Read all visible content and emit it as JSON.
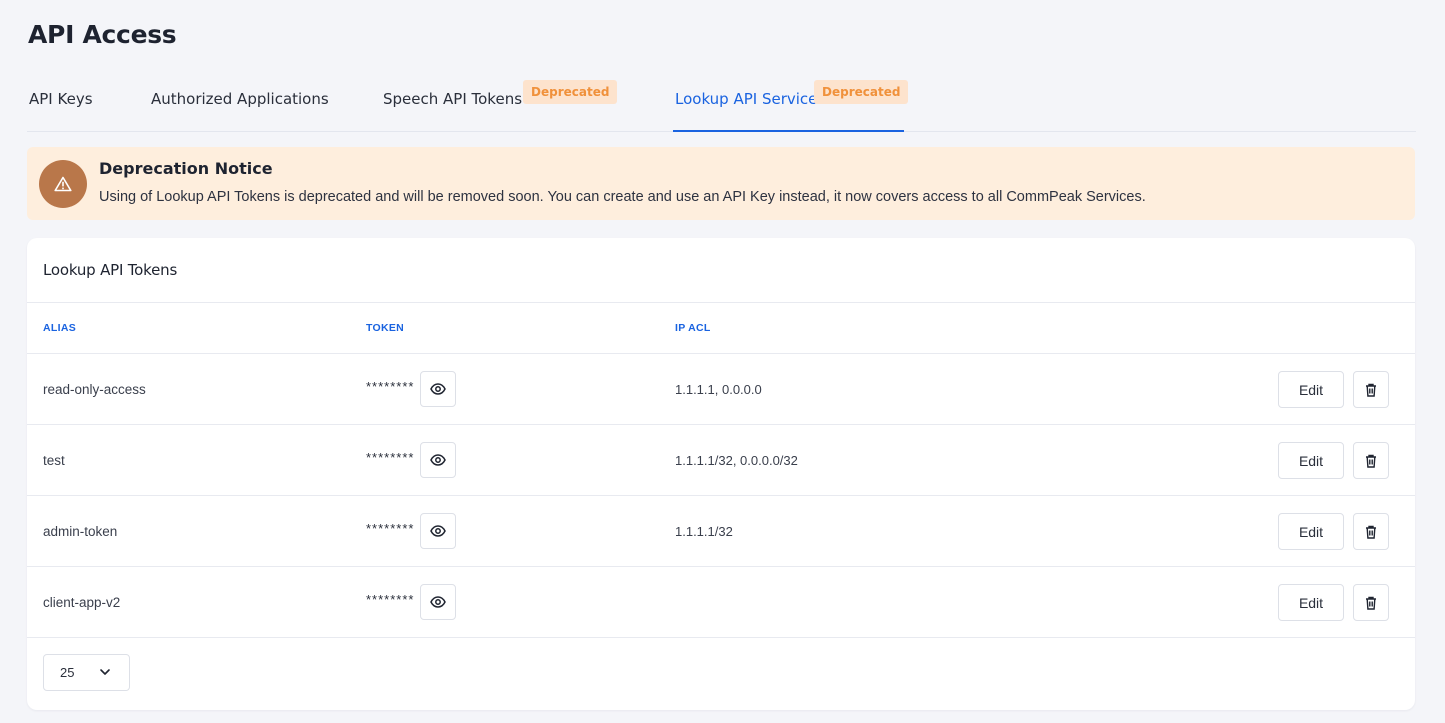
{
  "page_title": "API Access",
  "tabs": [
    {
      "label": "API Keys"
    },
    {
      "label": "Authorized Applications"
    },
    {
      "label": "Speech API Tokens",
      "badge": "Deprecated"
    },
    {
      "label": "Lookup API Service",
      "badge": "Deprecated",
      "active": true
    }
  ],
  "notice": {
    "title": "Deprecation Notice",
    "text": "Using of Lookup API Tokens is deprecated and will be removed soon. You can create and use an API Key instead, it now covers access to all CommPeak Services.",
    "icon": "warning-icon"
  },
  "card": {
    "title": "Lookup API Tokens",
    "columns": [
      "ALIAS",
      "TOKEN",
      "IP ACL"
    ],
    "rows": [
      {
        "alias": "read-only-access",
        "token": "********",
        "ip_acl": "1.1.1.1, 0.0.0.0",
        "edit": "Edit"
      },
      {
        "alias": "test",
        "token": "********",
        "ip_acl": "1.1.1.1/32, 0.0.0.0/32",
        "edit": "Edit"
      },
      {
        "alias": "admin-token",
        "token": "********",
        "ip_acl": "1.1.1.1/32",
        "edit": "Edit"
      },
      {
        "alias": "client-app-v2",
        "token": "********",
        "ip_acl": "",
        "edit": "Edit"
      }
    ],
    "page_size": "25"
  },
  "colors": {
    "accent": "#1a63e0",
    "badge_bg": "#fde3cd",
    "badge_text": "#f0913b",
    "notice_bg": "#feeedd",
    "notice_icon_bg": "#b9774a"
  }
}
